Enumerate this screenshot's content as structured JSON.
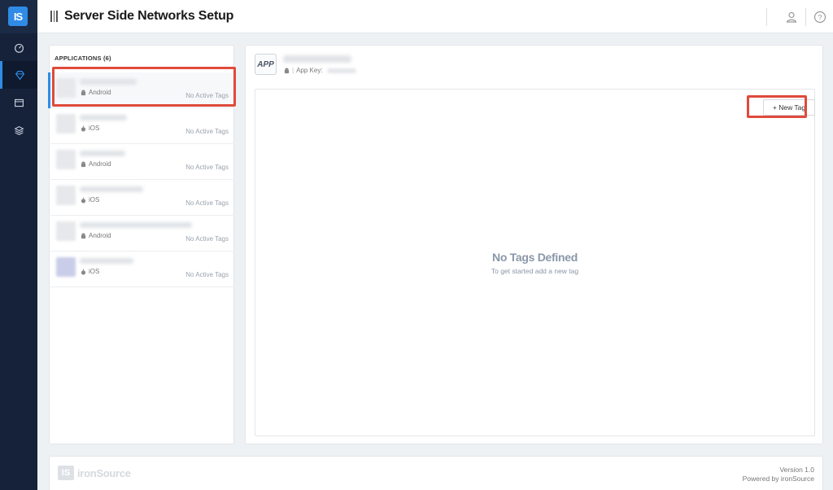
{
  "colors": {
    "accent": "#2f8be6",
    "sidebar": "#15223a",
    "highlight": "#e04a3c",
    "muted": "#8a97a8"
  },
  "sidebar": {
    "logo": "IS",
    "items": [
      {
        "icon": "gauge-icon",
        "active": false
      },
      {
        "icon": "diamond-icon",
        "active": true
      },
      {
        "icon": "folder-icon",
        "active": false
      },
      {
        "icon": "layers-icon",
        "active": false
      }
    ]
  },
  "header": {
    "title": "Server Side Networks Setup",
    "icons": [
      "user-icon",
      "help-icon"
    ]
  },
  "apps": {
    "header": "APPLICATIONS (6)",
    "items": [
      {
        "platform": "Android",
        "tags": "No Active Tags",
        "selected": true
      },
      {
        "platform": "iOS",
        "tags": "No Active Tags",
        "selected": false
      },
      {
        "platform": "Android",
        "tags": "No Active Tags",
        "selected": false
      },
      {
        "platform": "iOS",
        "tags": "No Active Tags",
        "selected": false
      },
      {
        "platform": "Android",
        "tags": "No Active Tags",
        "selected": false
      },
      {
        "platform": "iOS",
        "tags": "No Active Tags",
        "selected": false
      }
    ]
  },
  "detail": {
    "app_logo": "APP",
    "app_key_label": "App Key:",
    "new_tag_label": "+ New Tag",
    "empty_title": "No Tags Defined",
    "empty_subtitle": "To get started add a new tag"
  },
  "footer": {
    "logo_mark": "IS",
    "logo_text": "ironSource",
    "version": "Version 1.0",
    "powered_by": "Powered by ironSource"
  }
}
